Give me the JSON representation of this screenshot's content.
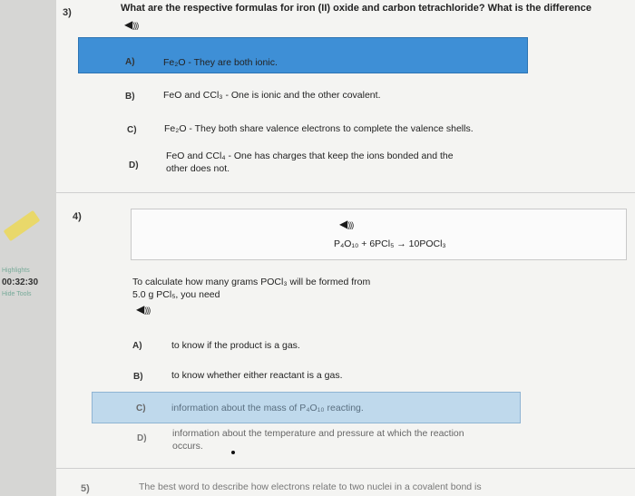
{
  "sidebar": {
    "top_label": "Highlights",
    "timer": "00:32:30",
    "hide_tools": "Hide Tools"
  },
  "q3": {
    "number": "3)",
    "text": "What are the respective formulas for iron (II) oxide and carbon tetrachloride? What is the difference",
    "options": [
      {
        "letter": "A)",
        "text": "Fe₂O - They are both ionic."
      },
      {
        "letter": "B)",
        "text": "FeO and CCl₃ - One is ionic and the other covalent."
      },
      {
        "letter": "C)",
        "text": "Fe₂O - They both share valence electrons to complete the valence shells."
      },
      {
        "letter": "D)",
        "text": "FeO and CCl₄ - One has charges that keep the ions bonded and the other does not."
      }
    ]
  },
  "q4": {
    "number": "4)",
    "equation": "P₄O₁₀ + 6PCl₅ → 10POCl₃",
    "text_line1": "To calculate how many grams POCl₃ will be formed from",
    "text_line2": "5.0 g PCl₅, you need",
    "options": [
      {
        "letter": "A)",
        "text": "to know if the product is a gas."
      },
      {
        "letter": "B)",
        "text": "to know whether either reactant is a gas."
      },
      {
        "letter": "C)",
        "text": "information about the mass of P₄O₁₀ reacting."
      },
      {
        "letter": "D)",
        "text": "information about the temperature and pressure at which the reaction occurs."
      }
    ]
  },
  "q5": {
    "number": "5)",
    "text": "The best word to describe how electrons relate to two nuclei in a covalent bond is"
  }
}
